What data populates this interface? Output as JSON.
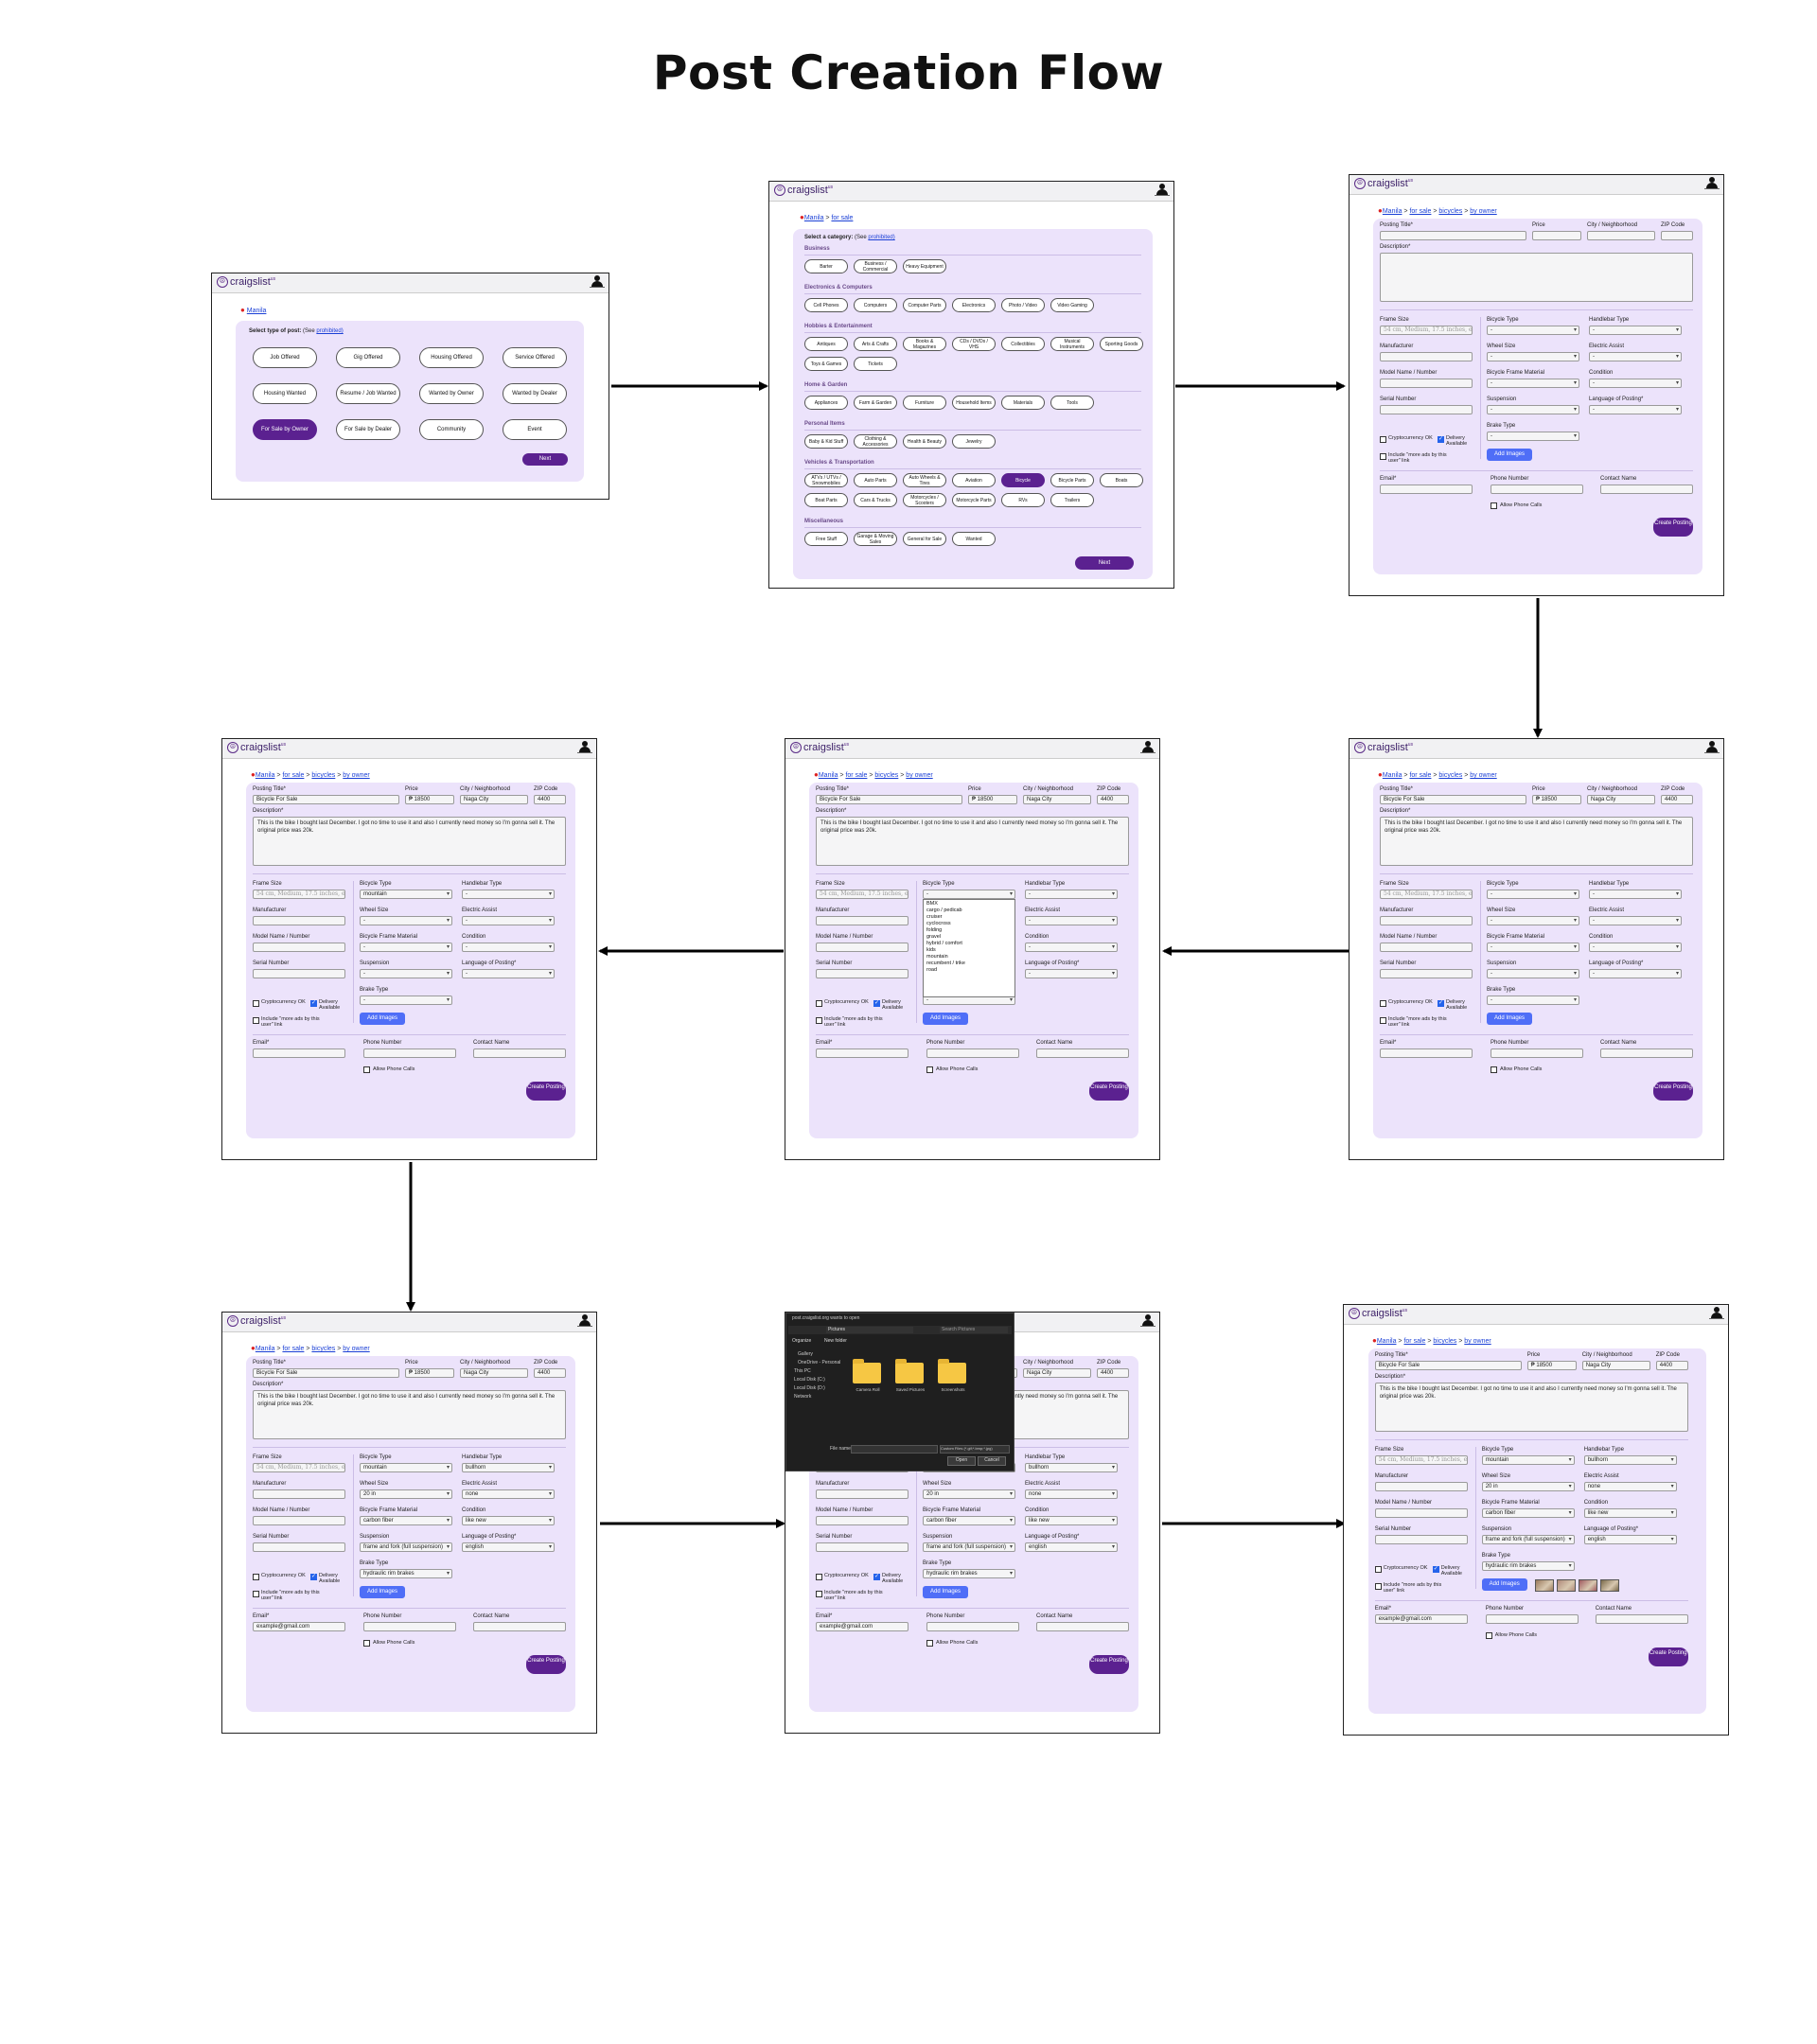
{
  "title": "Post Creation Flow",
  "brand": {
    "name": "craigslist",
    "sup": "us"
  },
  "type_screen": {
    "location": "Manila",
    "heading": "Select type of post:",
    "see": "(See",
    "prohibited": "prohibited)",
    "options": [
      "Job Offered",
      "Gig Offered",
      "Housing Offered",
      "Service Offered",
      "Housing Wanted",
      "Resume / Job Wanted",
      "Wanted by Owner",
      "Wanted by Dealer",
      "For Sale by Owner",
      "For Sale by Dealer",
      "Community",
      "Event"
    ],
    "selected": "For Sale by Owner",
    "next": "Next"
  },
  "category_screen": {
    "crumb": [
      "Manila",
      "for sale"
    ],
    "heading": "Select a category:",
    "see": "(See",
    "prohibited": "prohibited)",
    "sections": [
      {
        "name": "Business",
        "items": [
          "Barter",
          "Business / Commercial",
          "Heavy Equipment"
        ]
      },
      {
        "name": "Electronics & Computers",
        "items": [
          "Cell Phones",
          "Computers",
          "Computer Parts",
          "Electronics",
          "Photo / Video",
          "Video Gaming"
        ]
      },
      {
        "name": "Hobbies & Entertainment",
        "items": [
          "Antiques",
          "Arts & Crafts",
          "Books & Magazines",
          "CDs / DVDs / VHS",
          "Collectibles",
          "Musical Instruments",
          "Sporting Goods",
          "Toys & Games",
          "Tickets"
        ]
      },
      {
        "name": "Home & Garden",
        "items": [
          "Appliances",
          "Farm & Garden",
          "Furniture",
          "Household Items",
          "Materials",
          "Tools"
        ]
      },
      {
        "name": "Personal Items",
        "items": [
          "Baby & Kid Stuff",
          "Clothing & Accessories",
          "Health & Beauty",
          "Jewelry"
        ]
      },
      {
        "name": "Vehicles & Transportation",
        "items": [
          "ATVs / UTVs / Snowmobiles",
          "Auto Parts",
          "Auto Wheels & Tires",
          "Aviation",
          "Bicycle",
          "Bicycle Parts",
          "Boats",
          "Boat Parts",
          "Cars & Trucks",
          "Motorcycles / Scooters",
          "Motorcycle Parts",
          "RVs",
          "Trailers"
        ]
      },
      {
        "name": "Miscellaneous",
        "items": [
          "Free Stuff",
          "Garage & Moving Sales",
          "General for Sale",
          "Wanted"
        ]
      }
    ],
    "selected": "Bicycle",
    "next": "Next"
  },
  "form_labels": {
    "crumb": [
      "Manila",
      "for sale",
      "bicycles",
      "by owner"
    ],
    "posting_title": "Posting Title*",
    "price": "Price",
    "city": "City / Neighborhood",
    "zip": "ZIP Code",
    "description": "Description*",
    "frame_size": "Frame Size",
    "frame_placeholder": "54 cm, Medium, 17.5 inches, etc.",
    "manufacturer": "Manufacturer",
    "model": "Model Name / Number",
    "serial": "Serial Number",
    "bicycle_type": "Bicycle Type",
    "handlebar": "Handlebar Type",
    "wheel": "Wheel Size",
    "electric": "Electric Assist",
    "material": "Bicycle Frame Material",
    "condition": "Condition",
    "suspension": "Suspension",
    "language": "Language of Posting*",
    "brake": "Brake Type",
    "crypto": "Cryptocurrency OK",
    "delivery": "Delivery Available",
    "more_ads": "Include \"more ads by this user\" link",
    "add_images": "Add Images",
    "email": "Email*",
    "phone": "Phone Number",
    "contact": "Contact Name",
    "allow_calls": "Allow Phone Calls",
    "create": "Create Posting"
  },
  "filled": {
    "posting_title": "Bicycle For Sale",
    "price": "₱ 18500",
    "city": "Naga City",
    "zip": "4400",
    "description": "This is the bike I bought last December. I got no time to use it and also I currently need money so I'm gonna sell it. The original price was 20k.",
    "empty_select": "-",
    "bicycle_type": "mountain",
    "handlebar": "bullhorn",
    "wheel": "20 in",
    "electric": "none",
    "material": "carbon fiber",
    "condition": "like new",
    "suspension": "frame and fork (full suspension)",
    "language": "english",
    "brake": "hydraulic rim brakes",
    "email": "example@gmail.com"
  },
  "bike_type_options": [
    "BMX",
    "cargo / pedicab",
    "cruiser",
    "cyclocross",
    "folding",
    "gravel",
    "hybrid / comfort",
    "kids",
    "mountain",
    "recumbent / trike",
    "road"
  ],
  "explorer": {
    "title": "post.craigslist.org wants to open",
    "path": "Pictures",
    "search": "Search Pictures",
    "organize": "Organize",
    "new_folder": "New folder",
    "tree": [
      "Gallery",
      "OneDrive - Personal",
      "This PC",
      "Local Disk (C:)",
      "Local Disk (D:)",
      "Network"
    ],
    "folders": [
      "Camera Roll",
      "Saved Pictures",
      "Screenshots"
    ],
    "filename": "File name:",
    "filter": "Custom Files (*.gif;*.bmp;*.jpg)",
    "open": "Open",
    "cancel": "Cancel"
  }
}
